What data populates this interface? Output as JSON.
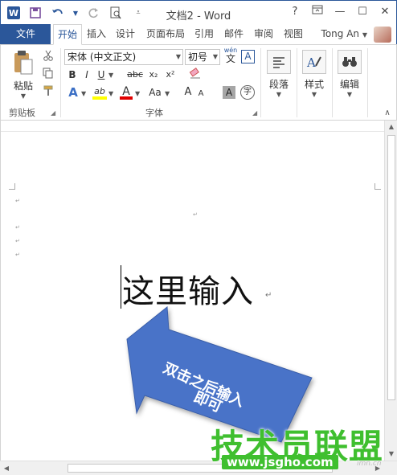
{
  "window": {
    "title": "文档2 - Word",
    "help": "?",
    "controls": {
      "ribbon_display": "▭",
      "minimize": "—",
      "maximize": "☐",
      "close": "✕"
    }
  },
  "quick_access": {
    "app_icon_letter": "W",
    "save": "save-icon",
    "undo": "undo-icon",
    "redo": "redo-icon",
    "print_preview": "print-preview-icon",
    "customize": "customize-qat-icon"
  },
  "tabs": [
    {
      "label": "文件"
    },
    {
      "label": "开始"
    },
    {
      "label": "插入"
    },
    {
      "label": "设计"
    },
    {
      "label": "页面布局"
    },
    {
      "label": "引用"
    },
    {
      "label": "邮件"
    },
    {
      "label": "审阅"
    },
    {
      "label": "视图"
    }
  ],
  "user": {
    "name": "Tong An"
  },
  "ribbon": {
    "clipboard": {
      "label": "剪贴板",
      "paste": "粘贴"
    },
    "font": {
      "label": "字体",
      "font_name": "宋体 (中文正文)",
      "font_size": "初号",
      "wen_top": "wén",
      "wen_bottom": "文",
      "boxed_a": "A",
      "bold": "B",
      "italic": "I",
      "underline": "U",
      "strikethrough": "abc",
      "subscript": "x₂",
      "superscript": "x²",
      "text_effects": "A",
      "highlight": "ab",
      "font_color": "A",
      "change_case": "Aa",
      "grow": "A",
      "shrink": "A",
      "shading": "A",
      "encircle": "字"
    },
    "paragraph": {
      "label": "段落"
    },
    "styles": {
      "label": "样式"
    },
    "editing": {
      "label": "编辑"
    }
  },
  "document": {
    "text": "这里输入",
    "enter_mark": "↵"
  },
  "callout": {
    "line1": "双击之后输入",
    "line2": "即可",
    "fill": "#4a73c8"
  },
  "watermark": {
    "site_name": "技术员联盟",
    "url": "www.jsgho.com",
    "small": "imn.cn"
  },
  "colors": {
    "accent": "#2b579a",
    "highlight_yellow": "#ffff00",
    "font_red": "#e00000"
  }
}
